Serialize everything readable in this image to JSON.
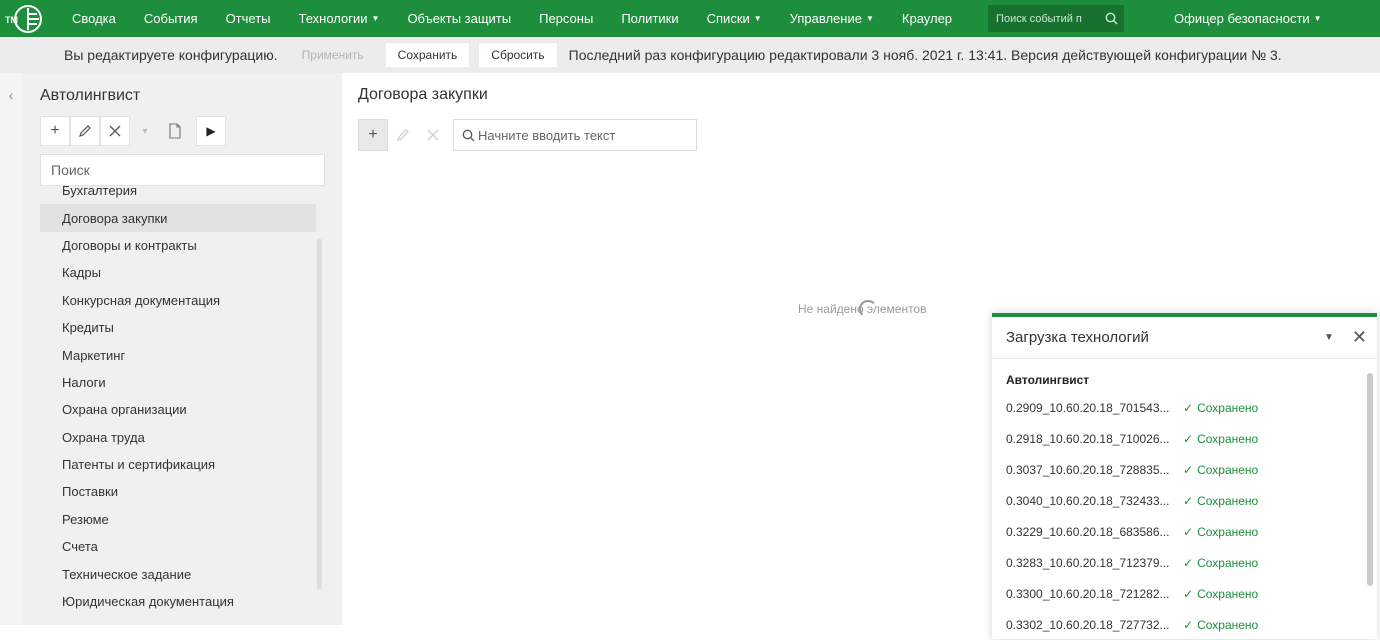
{
  "logo": {
    "text": "TM"
  },
  "nav": {
    "items": [
      {
        "label": "Сводка",
        "caret": false
      },
      {
        "label": "События",
        "caret": false
      },
      {
        "label": "Отчеты",
        "caret": false
      },
      {
        "label": "Технологии",
        "caret": true
      },
      {
        "label": "Объекты защиты",
        "caret": false
      },
      {
        "label": "Персоны",
        "caret": false
      },
      {
        "label": "Политики",
        "caret": false
      },
      {
        "label": "Списки",
        "caret": true
      },
      {
        "label": "Управление",
        "caret": true
      },
      {
        "label": "Краулер",
        "caret": false
      }
    ],
    "search_placeholder": "Поиск событий п",
    "user": "Офицер безопасности"
  },
  "config": {
    "message": "Вы редактируете конфигурацию.",
    "apply_label": "Применить",
    "save_label": "Сохранить",
    "reset_label": "Сбросить",
    "info": "Последний раз конфигурацию редактировали 3 нояб. 2021 г. 13:41. Версия действующей конфигурации № 3."
  },
  "left": {
    "title": "Автолингвист",
    "search_placeholder": "Поиск",
    "items": [
      {
        "label": "Бухгалтерия",
        "selected": false
      },
      {
        "label": "Договора закупки",
        "selected": true
      },
      {
        "label": "Договоры и контракты",
        "selected": false
      },
      {
        "label": "Кадры",
        "selected": false
      },
      {
        "label": "Конкурсная документация",
        "selected": false
      },
      {
        "label": "Кредиты",
        "selected": false
      },
      {
        "label": "Маркетинг",
        "selected": false
      },
      {
        "label": "Налоги",
        "selected": false
      },
      {
        "label": "Охрана организации",
        "selected": false
      },
      {
        "label": "Охрана труда",
        "selected": false
      },
      {
        "label": "Патенты и сертификация",
        "selected": false
      },
      {
        "label": "Поставки",
        "selected": false
      },
      {
        "label": "Резюме",
        "selected": false
      },
      {
        "label": "Счета",
        "selected": false
      },
      {
        "label": "Техническое задание",
        "selected": false
      },
      {
        "label": "Юридическая документация",
        "selected": false
      }
    ]
  },
  "main": {
    "title": "Договора закупки",
    "search_placeholder": "Начните вводить текст",
    "empty_message": "Не найдено элементов"
  },
  "upload": {
    "title": "Загрузка технологий",
    "section": "Автолингвист",
    "rows": [
      {
        "name": "0.2909_10.60.20.18_701543...",
        "status": "Сохранено"
      },
      {
        "name": "0.2918_10.60.20.18_710026...",
        "status": "Сохранено"
      },
      {
        "name": "0.3037_10.60.20.18_728835...",
        "status": "Сохранено"
      },
      {
        "name": "0.3040_10.60.20.18_732433...",
        "status": "Сохранено"
      },
      {
        "name": "0.3229_10.60.20.18_683586...",
        "status": "Сохранено"
      },
      {
        "name": "0.3283_10.60.20.18_712379...",
        "status": "Сохранено"
      },
      {
        "name": "0.3300_10.60.20.18_721282...",
        "status": "Сохранено"
      },
      {
        "name": "0.3302_10.60.20.18_727732...",
        "status": "Сохранено"
      }
    ]
  },
  "colors": {
    "brand": "#1d8f3c",
    "status_ok": "#1d8f3c"
  }
}
